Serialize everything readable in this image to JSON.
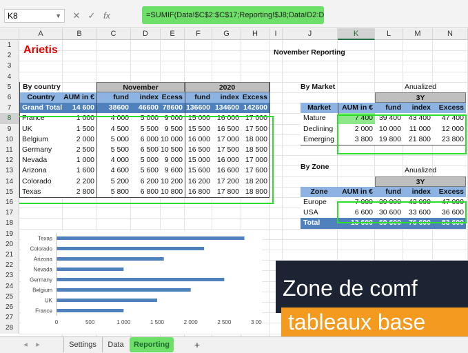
{
  "formula_bar": {
    "name_box": "K8",
    "cancel": "✕",
    "confirm": "✓",
    "fx": "fx",
    "formula": "=SUMIF(Data!$C$2:$C$17;Reporting!$J8;Data!D2:D9)"
  },
  "columns": [
    "A",
    "B",
    "C",
    "D",
    "E",
    "F",
    "G",
    "H",
    "I",
    "J",
    "K",
    "L",
    "M",
    "N"
  ],
  "rows": [
    "1",
    "2",
    "3",
    "4",
    "5",
    "6",
    "7",
    "8",
    "9",
    "10",
    "11",
    "12",
    "13",
    "14",
    "15",
    "16",
    "17",
    "18",
    "19",
    "20",
    "21",
    "22",
    "23",
    "24",
    "25",
    "26",
    "27",
    "28"
  ],
  "sheet": {
    "title": "Arietis",
    "report_title": "November Reporting",
    "by_country": {
      "section_label": "By country",
      "group_headers": [
        "November",
        "2020"
      ],
      "headers": [
        "Country",
        "AUM in €",
        "fund",
        "index",
        "Ecess",
        "fund",
        "index",
        "Excess"
      ],
      "grand_total": [
        "Grand Total",
        "14 600",
        "38600",
        "46600",
        "78600",
        "136600",
        "134600",
        "142600"
      ],
      "rows": [
        [
          "France",
          "1 000",
          "4 000",
          "5 000",
          "9 000",
          "15 000",
          "16 000",
          "17 000"
        ],
        [
          "UK",
          "1 500",
          "4 500",
          "5 500",
          "9 500",
          "15 500",
          "16 500",
          "17 500"
        ],
        [
          "Belgium",
          "2 000",
          "5 000",
          "6 000",
          "10 000",
          "16 000",
          "17 000",
          "18 000"
        ],
        [
          "Germany",
          "2 500",
          "5 500",
          "6 500",
          "10 500",
          "16 500",
          "17 500",
          "18 500"
        ],
        [
          "Nevada",
          "1 000",
          "4 000",
          "5 000",
          "9 000",
          "15 000",
          "16 000",
          "17 000"
        ],
        [
          "Arizona",
          "1 600",
          "4 600",
          "5 600",
          "9 600",
          "15 600",
          "16 600",
          "17 600"
        ],
        [
          "Colorado",
          "2 200",
          "5 200",
          "6 200",
          "10 200",
          "16 200",
          "17 200",
          "18 200"
        ],
        [
          "Texas",
          "2 800",
          "5 800",
          "6 800",
          "10 800",
          "16 800",
          "17 800",
          "18 800"
        ]
      ]
    },
    "by_market": {
      "section_label": "By Market",
      "annualized": "Anualized",
      "period": "3Y",
      "headers": [
        "Market",
        "AUM in €",
        "fund",
        "index",
        "Excess"
      ],
      "rows": [
        [
          "Mature",
          "7 400",
          "39 400",
          "43 400",
          "47 400"
        ],
        [
          "Declining",
          "2 000",
          "10 000",
          "11 000",
          "12 000"
        ],
        [
          "Emerging",
          "3 800",
          "19 800",
          "21 800",
          "23 800"
        ]
      ]
    },
    "by_zone": {
      "section_label": "By Zone",
      "annualized": "Anualized",
      "period": "3Y",
      "headers": [
        "Zone",
        "AUM in €",
        "fund",
        "index",
        "Excess"
      ],
      "rows": [
        [
          "Europe",
          "7 000",
          "39 000",
          "43 000",
          "47 000"
        ],
        [
          "USA",
          "6 600",
          "30 600",
          "33 600",
          "36 600"
        ]
      ],
      "total": [
        "Total",
        "13 600",
        "69 600",
        "76 600",
        "83 600"
      ]
    }
  },
  "chart_data": {
    "type": "bar",
    "orientation": "horizontal",
    "categories": [
      "Texas",
      "Colorado",
      "Arizona",
      "Nevada",
      "Germany",
      "Belgium",
      "UK",
      "France"
    ],
    "values": [
      2800,
      2200,
      1600,
      1000,
      2500,
      2000,
      1500,
      1000
    ],
    "xlim": [
      0,
      3000
    ],
    "xticks": [
      "0",
      "500",
      "1 000",
      "1 500",
      "2 000",
      "2 500",
      "3 000"
    ],
    "bar_color": "#4f81bd",
    "grid": false
  },
  "tabs": {
    "prev": "◂",
    "next": "▸",
    "items": [
      "Settings",
      "Data",
      "Reporting"
    ],
    "active": "Reporting",
    "add": "+"
  },
  "overlay": {
    "line1": "Zone de comf",
    "line2": "tableaux base"
  },
  "colors": {
    "highlight": "#2bde2b",
    "title_red": "#e60000",
    "header_blue": "#8db3e2",
    "header_dark": "#4f81bd",
    "overlay_orange": "#f39a1f",
    "overlay_dark": "#1c2333"
  }
}
